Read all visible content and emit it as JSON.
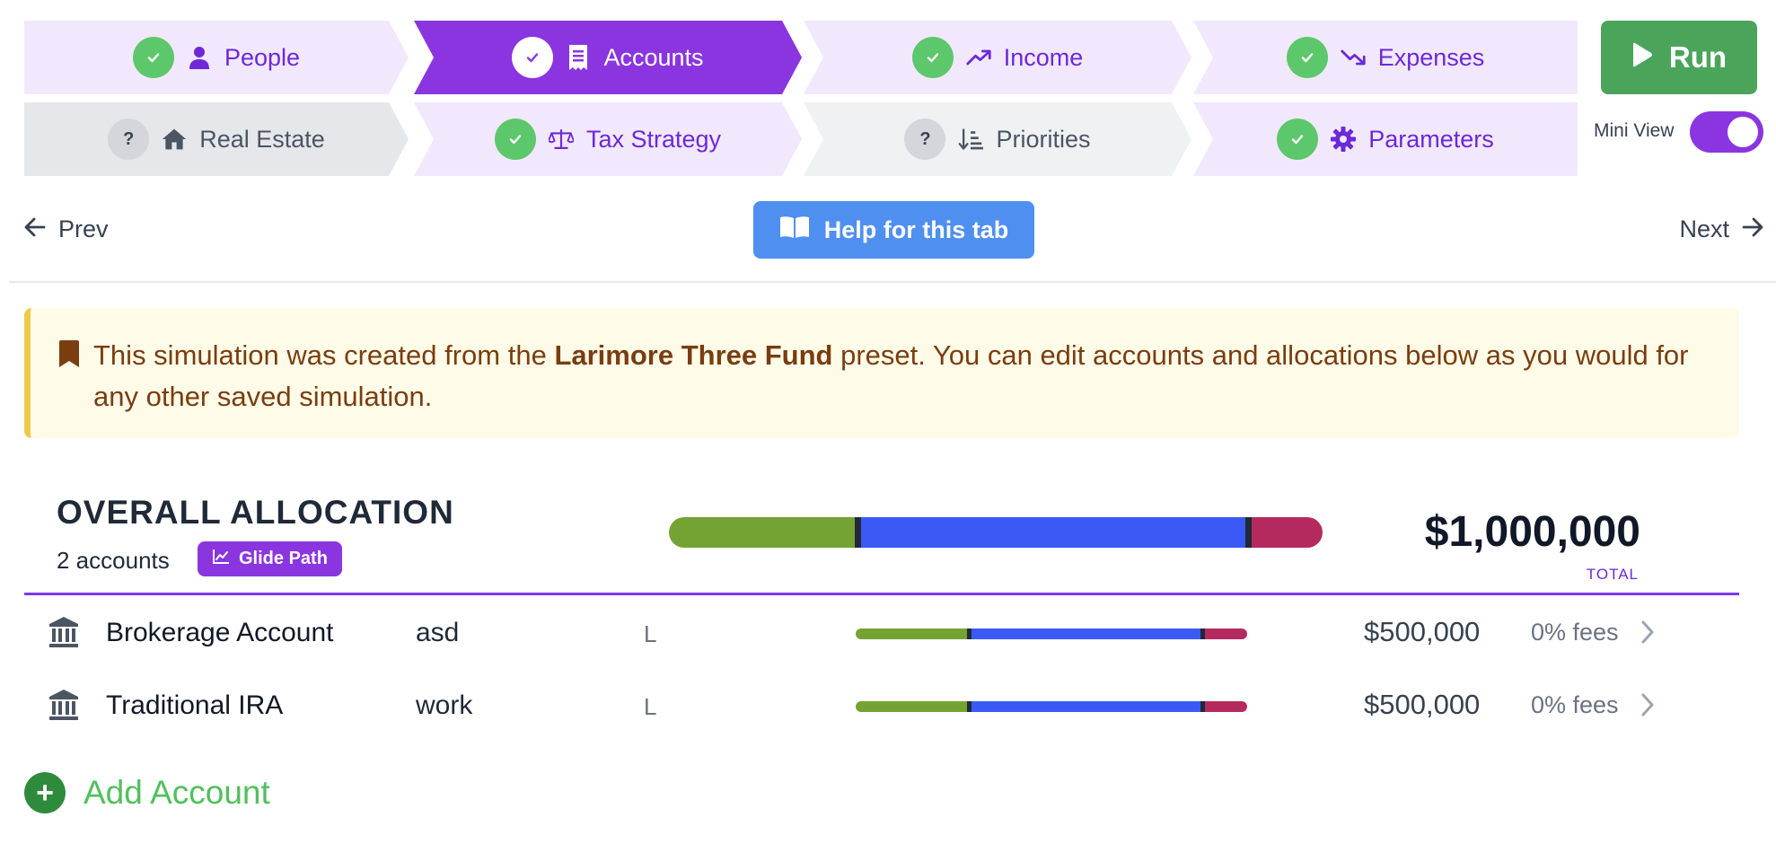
{
  "steps": {
    "people": {
      "label": "People",
      "state": "done"
    },
    "accounts": {
      "label": "Accounts",
      "state": "active"
    },
    "income": {
      "label": "Income",
      "state": "done"
    },
    "expenses": {
      "label": "Expenses",
      "state": "done"
    },
    "real_estate": {
      "label": "Real Estate",
      "state": "unknown"
    },
    "tax_strategy": {
      "label": "Tax Strategy",
      "state": "done"
    },
    "priorities": {
      "label": "Priorities",
      "state": "unknown"
    },
    "parameters": {
      "label": "Parameters",
      "state": "done"
    },
    "unknown_badge": "?"
  },
  "run": {
    "label": "Run"
  },
  "mini_view": {
    "label": "Mini View",
    "on": true
  },
  "nav": {
    "prev": "Prev",
    "next": "Next",
    "help": "Help for this tab"
  },
  "notice": {
    "prefix": "This simulation was created from the ",
    "preset": "Larimore Three Fund",
    "suffix": " preset. You can edit accounts and allocations below as you would for any other saved simulation."
  },
  "allocation": {
    "title": "OVERALL ALLOCATION",
    "count": "2 accounts",
    "glide_label": "Glide Path",
    "total": "$1,000,000",
    "total_label": "TOTAL",
    "mix": [
      0.29,
      0.6,
      0.11
    ],
    "colors": [
      "#74a334",
      "#3b59f5",
      "#b52a5e"
    ]
  },
  "accounts": [
    {
      "name": "Brokerage Account",
      "tag": "asd",
      "letter": "L",
      "amount": "$500,000",
      "fees": "0% fees",
      "mix": [
        0.29,
        0.6,
        0.11
      ]
    },
    {
      "name": "Traditional IRA",
      "tag": "work",
      "letter": "L",
      "amount": "$500,000",
      "fees": "0% fees",
      "mix": [
        0.29,
        0.6,
        0.11
      ]
    }
  ],
  "add_account": {
    "label": "Add Account",
    "symbol": "+"
  }
}
